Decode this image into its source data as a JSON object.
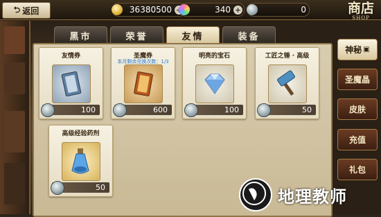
{
  "header": {
    "back_label": "返回",
    "gold": {
      "icon": "coin-icon",
      "value": "36380500"
    },
    "crystal": {
      "icon": "crystal-icon",
      "value": "340"
    },
    "friendship": {
      "icon": "friendship-coin-icon",
      "value": "0"
    },
    "shop_title": "商店",
    "shop_title_en": "SHOP"
  },
  "tabs": [
    {
      "label": "黑市",
      "active": false
    },
    {
      "label": "荣誉",
      "active": false
    },
    {
      "label": "友情",
      "active": true
    },
    {
      "label": "装备",
      "active": false
    }
  ],
  "items": [
    {
      "name": "友情券",
      "price": "100",
      "icon": "ticket-icon"
    },
    {
      "name": "圣魔券",
      "subtitle": "本月剩余兑换次数：1/3",
      "price": "600",
      "icon": "holy-ticket-icon"
    },
    {
      "name": "明亮的宝石",
      "price": "100",
      "icon": "gem-icon"
    },
    {
      "name": "工匠之锤 · 高级",
      "price": "50",
      "icon": "hammer-icon"
    },
    {
      "name": "高级经验药剂",
      "price": "50",
      "icon": "potion-icon"
    }
  ],
  "side_menu": [
    {
      "label": "神秘",
      "active": true
    },
    {
      "label": "圣魔晶",
      "active": false
    },
    {
      "label": "皮肤",
      "active": false
    },
    {
      "label": "充值",
      "active": false
    },
    {
      "label": "礼包",
      "active": false
    }
  ],
  "watermark": "地理教师",
  "colors": {
    "accent": "#2a7ad0",
    "panel": "#d9cdb0",
    "tab_active": "#f7efd8"
  }
}
